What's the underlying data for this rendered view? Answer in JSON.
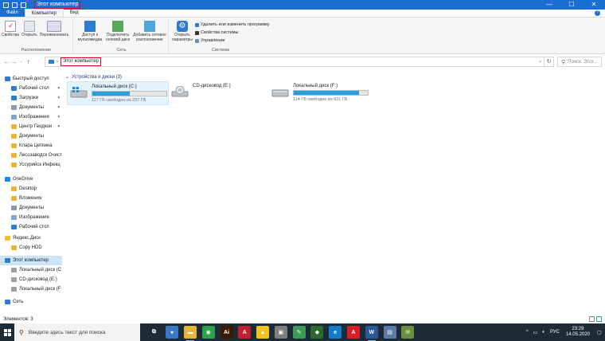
{
  "window": {
    "title": "Этот компьютер",
    "minimize": "—",
    "maximize": "☐",
    "close": "✕"
  },
  "ribbon_tabs": [
    "Файл",
    "Компьютер",
    "Вид"
  ],
  "help": "?",
  "ribbon": {
    "groups": {
      "location": "Расположение",
      "network": "Сеть",
      "system": "Система"
    },
    "buttons": {
      "properties": "Свойства",
      "open": "Открыть",
      "rename": "Переименовать",
      "media_access": "Доступ к мультимедиа",
      "map_drive": "Подключить сетевой диск",
      "add_location": "Добавить сетевое расположение",
      "open_settings": "Открыть параметры",
      "uninstall": "Удалить или изменить программу",
      "system_props": "Свойства системы",
      "manage": "Управление"
    }
  },
  "address": {
    "path": "Этот компьютер",
    "search_placeholder": "Поиск: Этот..."
  },
  "sidebar": {
    "items": [
      {
        "label": "Быстрый доступ",
        "icon": "star-icon",
        "pinned": false,
        "indent": 0
      },
      {
        "label": "Рабочий стол",
        "icon": "desktop-folder-icon",
        "pinned": true,
        "indent": 1
      },
      {
        "label": "Загрузки",
        "icon": "download-folder-icon",
        "pinned": true,
        "indent": 1
      },
      {
        "label": "Документы",
        "icon": "documents-folder-icon",
        "pinned": true,
        "indent": 1
      },
      {
        "label": "Изображения",
        "icon": "pictures-folder-icon",
        "pinned": true,
        "indent": 1
      },
      {
        "label": "Центр Геодези",
        "icon": "folder-icon",
        "pinned": true,
        "indent": 1
      },
      {
        "label": "Документы",
        "icon": "folder-icon",
        "pinned": false,
        "indent": 1
      },
      {
        "label": "Клара Цеткина",
        "icon": "folder-icon",
        "pinned": false,
        "indent": 1
      },
      {
        "label": "Лесозаводск Очист",
        "icon": "folder-icon",
        "pinned": false,
        "indent": 1
      },
      {
        "label": "Уссурийск Инфекц",
        "icon": "folder-icon",
        "pinned": false,
        "indent": 1
      },
      {
        "label": "OneDrive",
        "icon": "cloud-icon",
        "pinned": false,
        "indent": 0
      },
      {
        "label": "Desktop",
        "icon": "folder-icon",
        "pinned": false,
        "indent": 1
      },
      {
        "label": "Вложения",
        "icon": "folder-icon",
        "pinned": false,
        "indent": 1
      },
      {
        "label": "Документы",
        "icon": "documents-folder-icon",
        "pinned": false,
        "indent": 1
      },
      {
        "label": "Изображения",
        "icon": "pictures-folder-icon",
        "pinned": false,
        "indent": 1
      },
      {
        "label": "Рабочий стол",
        "icon": "desktop-folder-icon",
        "pinned": false,
        "indent": 1
      },
      {
        "label": "Яндекс.Диск",
        "icon": "yandex-disk-icon",
        "pinned": false,
        "indent": 0
      },
      {
        "label": "Copy HDD",
        "icon": "folder-icon",
        "pinned": false,
        "indent": 1
      },
      {
        "label": "Этот компьютер",
        "icon": "computer-icon",
        "pinned": false,
        "indent": 0,
        "selected": true
      },
      {
        "label": "Локальный диск (С",
        "icon": "drive-icon",
        "pinned": false,
        "indent": 1
      },
      {
        "label": "CD-дисковод (E:)",
        "icon": "cd-drive-icon",
        "pinned": false,
        "indent": 1
      },
      {
        "label": "Локальный диск (F",
        "icon": "drive-icon",
        "pinned": false,
        "indent": 1
      },
      {
        "label": "Сеть",
        "icon": "network-icon",
        "pinned": false,
        "indent": 0
      }
    ],
    "pin_glyph": "📌"
  },
  "content": {
    "group_title": "Устройства и диски (3)",
    "drives": [
      {
        "name": "Локальный диск (C:)",
        "free": "117 ГБ свободно из 237 ГБ",
        "used_fraction": 0.51,
        "type": "hdd"
      },
      {
        "name": "CD-дисковод (E:)",
        "free": "",
        "used_fraction": null,
        "type": "cd"
      },
      {
        "name": "Локальный диск (F:)",
        "free": "114 ГБ свободно из 931 ГБ",
        "used_fraction": 0.88,
        "type": "hdd"
      }
    ]
  },
  "statusbar": {
    "items_count": "Элементов: 3"
  },
  "taskbar": {
    "search_placeholder": "Введите здесь текст для поиска",
    "apps": [
      {
        "name": "task-view-icon",
        "color": "#1d2b36",
        "glyph": "⧉",
        "running": false
      },
      {
        "name": "chrome-icon",
        "color": "#3a77c4",
        "glyph": "●",
        "running": false
      },
      {
        "name": "file-explorer-icon",
        "color": "#e8b537",
        "glyph": "▬",
        "running": true
      },
      {
        "name": "maps-icon",
        "color": "#2aa14b",
        "glyph": "◉",
        "running": false
      },
      {
        "name": "illustrator-icon",
        "color": "#3b1a00",
        "glyph": "Ai",
        "running": false
      },
      {
        "name": "autocad-icon",
        "color": "#c21f2f",
        "glyph": "A",
        "running": false
      },
      {
        "name": "archicad-icon",
        "color": "#f2c318",
        "glyph": "▲",
        "running": false
      },
      {
        "name": "photos-icon",
        "color": "#7e7e7e",
        "glyph": "▣",
        "running": false
      },
      {
        "name": "notepad-icon",
        "color": "#3f9a55",
        "glyph": "✎",
        "running": false
      },
      {
        "name": "photoshop-icon",
        "color": "#2b6a2b",
        "glyph": "◆",
        "running": false
      },
      {
        "name": "edge-icon",
        "color": "#0f7cce",
        "glyph": "e",
        "running": false
      },
      {
        "name": "acrobat-icon",
        "color": "#d81f26",
        "glyph": "A",
        "running": false
      },
      {
        "name": "word-icon",
        "color": "#2b579a",
        "glyph": "W",
        "running": true
      },
      {
        "name": "image-viewer-icon",
        "color": "#5a7ca7",
        "glyph": "▤",
        "running": false
      },
      {
        "name": "mail-icon",
        "color": "#6a8f3a",
        "glyph": "✉",
        "running": false
      }
    ],
    "tray": {
      "lang": "РУС",
      "time": "23:29",
      "date": "14.05.2020"
    }
  }
}
